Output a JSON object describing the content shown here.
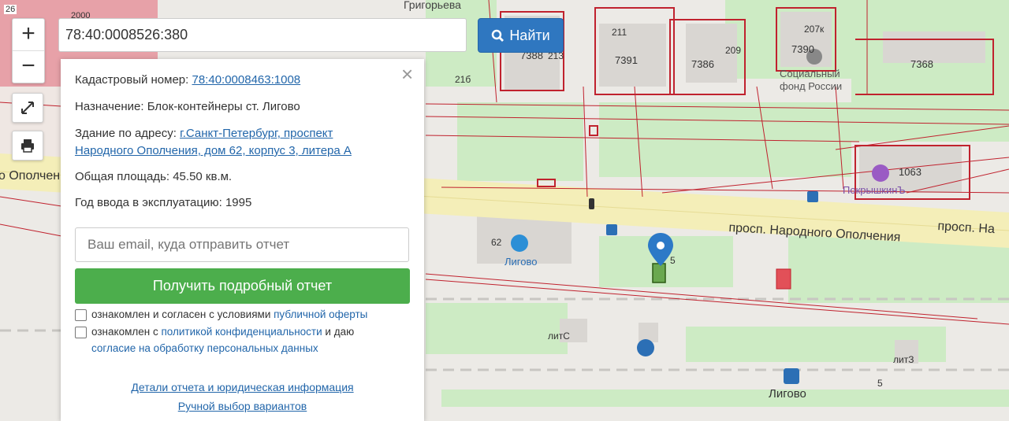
{
  "map": {
    "labels": {
      "num_2000": "2000",
      "num_26": "26",
      "grigoryeva": "Григорьева",
      "num_211": "211",
      "num_209": "209",
      "num_213": "213",
      "num_21b": "21б",
      "num_207k": "207к",
      "plot_7388": "7388",
      "plot_7391": "7391",
      "plot_7386": "7386",
      "plot_7390": "7390",
      "plot_7368": "7368",
      "plot_1063": "1063",
      "social_fund_1": "Социальный",
      "social_fund_2": "фонд России",
      "pokryshkin": "ПокрышкинЪ",
      "prospect_main": "просп. Народного Ополчения",
      "prospect_right": "просп. На",
      "prospect_left": "о Ополчен",
      "num_62": "62",
      "ligovo_store": "Лигово",
      "num_5_marker": "5",
      "lit_c": "литС",
      "lit_z": "литЗ",
      "ligovo_station": "Лигово",
      "num_5_bottom": "5"
    }
  },
  "controls": {
    "zoom_in": "+",
    "zoom_out": "−"
  },
  "search": {
    "value": "78:40:0008526:380",
    "button_label": "Найти"
  },
  "info": {
    "close": "×",
    "cadastral_label": "Кадастровый номер:",
    "cadastral_value": "78:40:0008463:1008",
    "purpose_label": "Назначение:",
    "purpose_value": "Блок-контейнеры ст. Лигово",
    "address_label": "Здание по адресу:",
    "address_line1": "г.Санкт-Петербург, проспект",
    "address_line2": "Народного Ополчения, дом 62, корпус 3, литера А",
    "area_label": "Общая площадь:",
    "area_value": "45.50 кв.м.",
    "year_label": "Год ввода в эксплуатацию:",
    "year_value": "1995",
    "email_placeholder": "Ваш email, куда отправить отчет",
    "report_button": "Получить подробный отчет",
    "consent1_text": "ознакомлен и согласен с условиями",
    "consent1_link": "публичной оферты",
    "consent2_text": "ознакомлен с",
    "consent2_link": "политикой конфиденциальности",
    "consent2_text2": "и даю",
    "consent2_link2": "согласие на обработку персональных данных",
    "details_link": "Детали отчета и юридическая информация",
    "manual_link": "Ручной выбор вариантов"
  },
  "colors": {
    "parcel_line": "#c0222e",
    "park_green": "#cdebc4",
    "road_yellow": "#f4eeb8",
    "search_button": "#2f77c0",
    "report_button": "#4cae4c",
    "marker": "#2c79c7"
  }
}
